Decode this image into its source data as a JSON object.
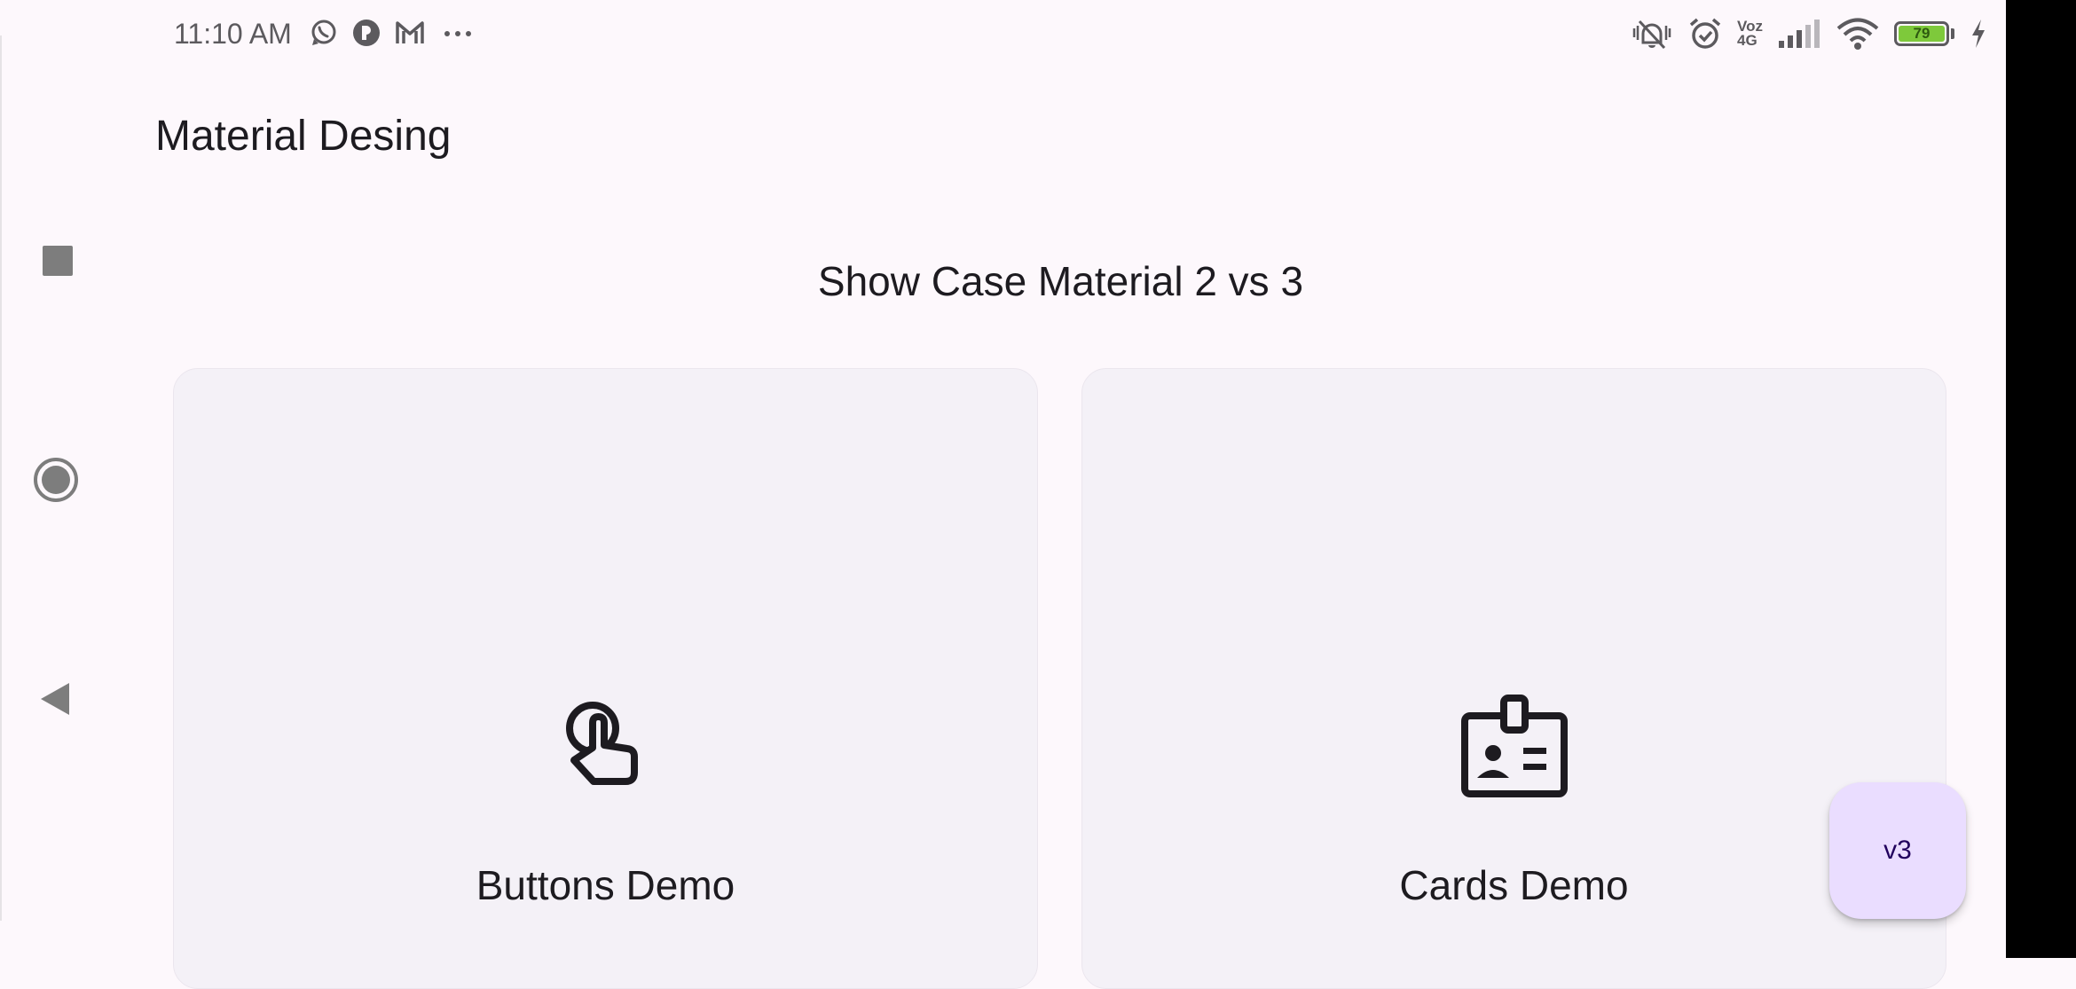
{
  "status_bar": {
    "time": "11:10 AM",
    "notification_icons": [
      "whatsapp-icon",
      "app-icon",
      "gmail-icon",
      "more-notifications-icon"
    ],
    "carrier_label_top": "Voz",
    "carrier_label_bottom": "4G",
    "battery_level": "79",
    "status_icons": [
      "silent-mode-icon",
      "alarm-icon",
      "signal-icon",
      "wifi-icon",
      "battery-icon",
      "charging-icon"
    ]
  },
  "nav_bar": {
    "buttons": [
      "recents-button",
      "home-button",
      "back-button"
    ]
  },
  "app_bar": {
    "title": "Material Desing"
  },
  "main": {
    "heading": "Show Case Material 2 vs 3",
    "cards": [
      {
        "label": "Buttons Demo",
        "icon": "touch-app-icon"
      },
      {
        "label": "Cards Demo",
        "icon": "badge-icon"
      }
    ]
  },
  "fab": {
    "label": "v3"
  },
  "colors": {
    "background": "#fdf8fc",
    "card": "#f4f1f7",
    "fab": "#eaddff",
    "battery": "#7ec93b",
    "text": "#1d1b20"
  }
}
